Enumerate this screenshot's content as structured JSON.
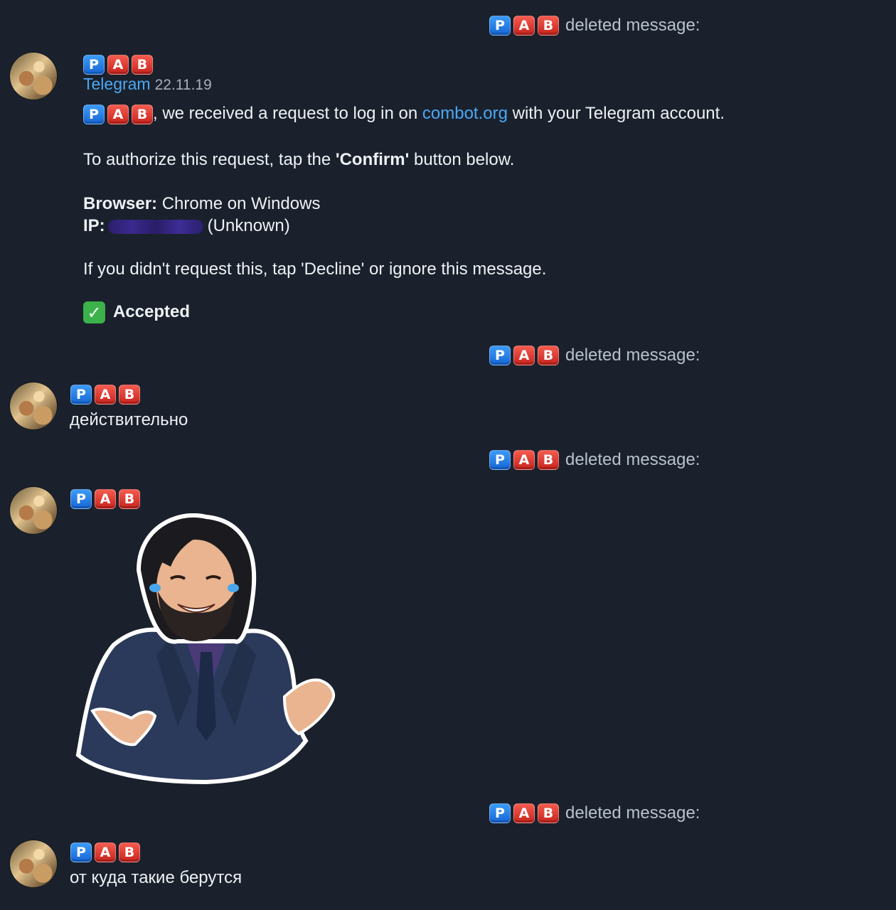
{
  "sender": {
    "badges": [
      {
        "letter": "P",
        "color": "#1a72e6"
      },
      {
        "letter": "A",
        "color": "#dd3128"
      },
      {
        "letter": "B",
        "color": "#dd3128"
      }
    ]
  },
  "service_messages": [
    {
      "text": "deleted message:"
    },
    {
      "text": "deleted message:"
    },
    {
      "text": "deleted message:"
    },
    {
      "text": "deleted message:"
    }
  ],
  "message1": {
    "forward_name": "Telegram",
    "forward_date": "22.11.19",
    "line1_part1": ", we received a request to log in on ",
    "line1_link": "combot.org",
    "line1_part2": " with your Telegram account.",
    "line2_part1": "To authorize this request, tap the ",
    "line2_bold": "'Confirm'",
    "line2_part2": " button below.",
    "browser_label": "Browser:",
    "browser_value": " Chrome on Windows",
    "ip_label": "IP:",
    "ip_value": "(Unknown)",
    "line5": "If you didn't request this, tap 'Decline' or ignore this message.",
    "status_icon": "check-mark-icon",
    "status_text": "Accepted"
  },
  "message2": {
    "text": "действительно"
  },
  "message3": {
    "sticker": "keanu-reeves-shrug-sticker"
  },
  "message4": {
    "text": "от куда такие берутся"
  }
}
